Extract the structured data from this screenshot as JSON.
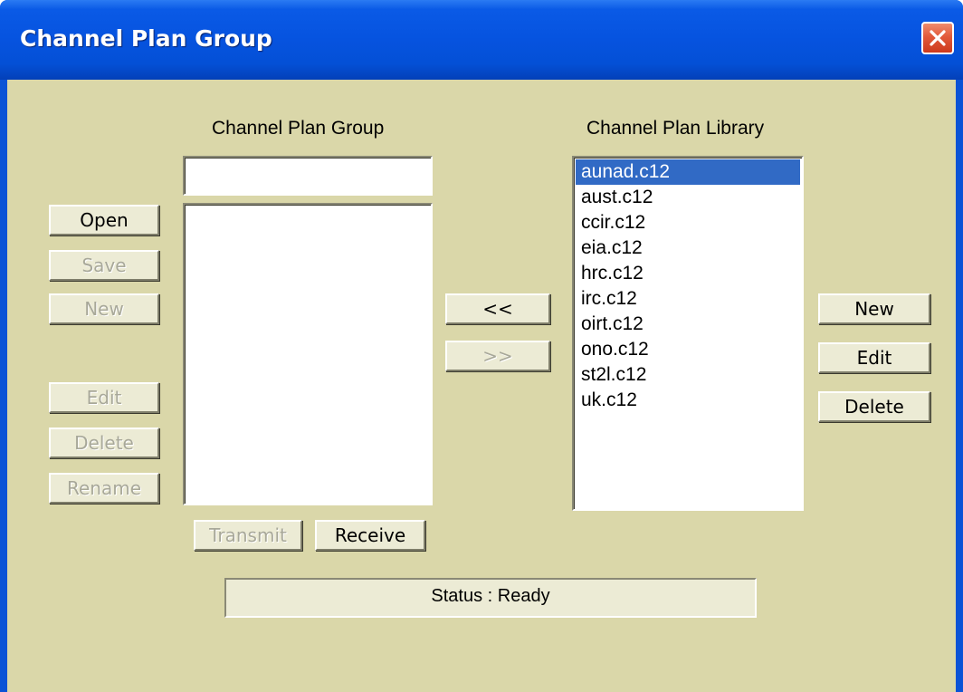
{
  "window": {
    "title": "Channel Plan Group"
  },
  "group_panel": {
    "heading": "Channel Plan Group",
    "name_value": "",
    "items": []
  },
  "library_panel": {
    "heading": "Channel Plan Library",
    "items": [
      {
        "label": "aunad.c12",
        "selected": true
      },
      {
        "label": "aust.c12",
        "selected": false
      },
      {
        "label": "ccir.c12",
        "selected": false
      },
      {
        "label": "eia.c12",
        "selected": false
      },
      {
        "label": "hrc.c12",
        "selected": false
      },
      {
        "label": "irc.c12",
        "selected": false
      },
      {
        "label": "oirt.c12",
        "selected": false
      },
      {
        "label": "ono.c12",
        "selected": false
      },
      {
        "label": "st2l.c12",
        "selected": false
      },
      {
        "label": "uk.c12",
        "selected": false
      }
    ]
  },
  "left_buttons": {
    "open": "Open",
    "save": "Save",
    "new": "New",
    "edit": "Edit",
    "delete": "Delete",
    "rename": "Rename"
  },
  "transfer_buttons": {
    "add": "<<",
    "remove": ">>"
  },
  "right_buttons": {
    "new": "New",
    "edit": "Edit",
    "delete": "Delete"
  },
  "bottom_buttons": {
    "transmit": "Transmit",
    "receive": "Receive"
  },
  "status": {
    "text": "Status : Ready"
  }
}
